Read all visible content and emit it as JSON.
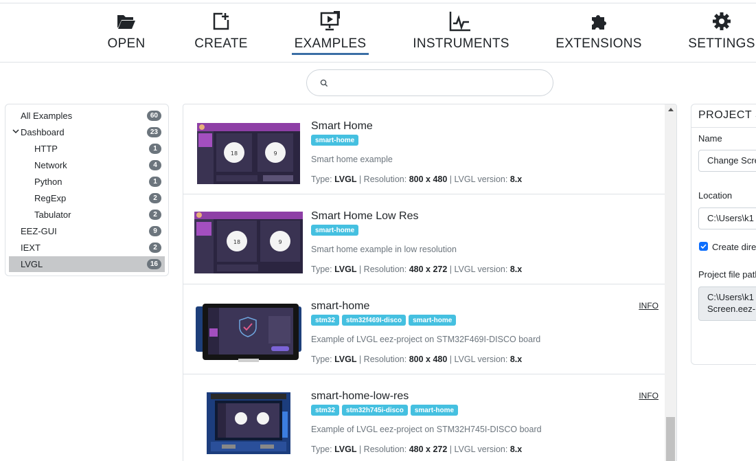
{
  "toolbar": {
    "items": [
      {
        "label": "OPEN",
        "icon": "folder-open-icon"
      },
      {
        "label": "CREATE",
        "icon": "file-plus-icon"
      },
      {
        "label": "EXAMPLES",
        "icon": "monitor-play-icon",
        "active": true
      },
      {
        "label": "INSTRUMENTS",
        "icon": "chart-line-icon"
      },
      {
        "label": "EXTENSIONS",
        "icon": "puzzle-icon"
      },
      {
        "label": "SETTINGS",
        "icon": "gear-icon"
      }
    ]
  },
  "search": {
    "value": "",
    "placeholder": ""
  },
  "tree": {
    "items": [
      {
        "label": "All Examples",
        "count": "60"
      },
      {
        "label": "Dashboard",
        "count": "23",
        "expanded": true
      },
      {
        "label": "HTTP",
        "count": "1"
      },
      {
        "label": "Network",
        "count": "4"
      },
      {
        "label": "Python",
        "count": "1"
      },
      {
        "label": "RegExp",
        "count": "2"
      },
      {
        "label": "Tabulator",
        "count": "2"
      },
      {
        "label": "EEZ-GUI",
        "count": "9"
      },
      {
        "label": "IEXT",
        "count": "2"
      },
      {
        "label": "LVGL",
        "count": "16",
        "selected": true
      }
    ]
  },
  "examples": {
    "type_label": "Type:",
    "resolution_label": "Resolution:",
    "version_label": "LVGL version:",
    "info_label": "INFO",
    "items": [
      {
        "title": "Smart Home",
        "tags": [
          "smart-home"
        ],
        "description": "Smart home example",
        "type": "LVGL",
        "resolution": "800 x 480",
        "version": "8.x",
        "info": false
      },
      {
        "title": "Smart Home Low Res",
        "tags": [
          "smart-home"
        ],
        "description": "Smart home example in low resolution",
        "type": "LVGL",
        "resolution": "480 x 272",
        "version": "8.x",
        "info": false
      },
      {
        "title": "smart-home",
        "tags": [
          "stm32",
          "stm32f469I-disco",
          "smart-home"
        ],
        "description": "Example of LVGL eez-project on STM32F469I-DISCO board",
        "type": "LVGL",
        "resolution": "800 x 480",
        "version": "8.x",
        "info": true
      },
      {
        "title": "smart-home-low-res",
        "tags": [
          "stm32",
          "stm32h745i-disco",
          "smart-home"
        ],
        "description": "Example of LVGL eez-project on STM32H745I-DISCO board",
        "type": "LVGL",
        "resolution": "480 x 272",
        "version": "8.x",
        "info": true
      }
    ]
  },
  "project_settings": {
    "header": "PROJECT SETTINGS",
    "name_label": "Name",
    "name_value": "Change Screen",
    "location_label": "Location",
    "location_value": "C:\\Users\\k1",
    "create_dir_label": "Create directory",
    "create_dir_checked": true,
    "file_path_label": "Project file path",
    "file_path_value_line1": "C:\\Users\\k1",
    "file_path_value_line2": "Screen.eez-project"
  },
  "colors": {
    "accent": "#3a6ea5",
    "tag": "#45c0e0",
    "badge": "#6c757d",
    "selected": "#c6c8ca"
  }
}
